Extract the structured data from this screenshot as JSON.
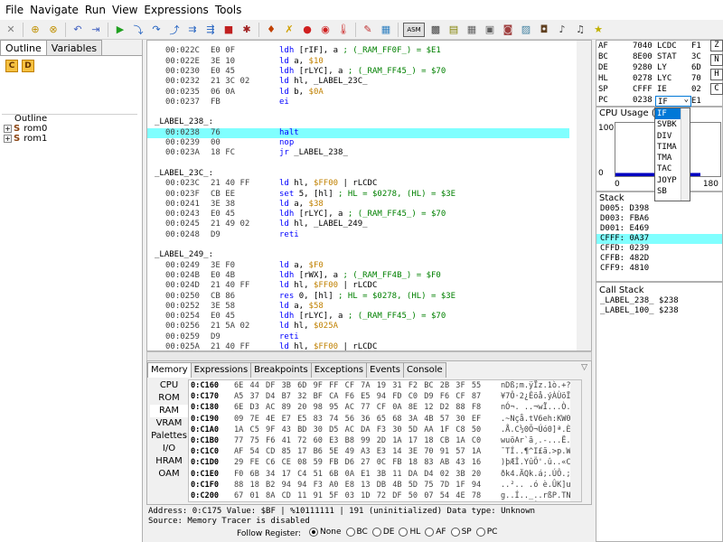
{
  "menu": [
    "File",
    "Navigate",
    "Run",
    "View",
    "Expressions",
    "Tools"
  ],
  "toolbar_icons": [
    "close-icon",
    "breakpoint-add-icon",
    "breakpoint-remove-icon",
    "step-back-icon",
    "goto-icon",
    "run-icon",
    "step-into-icon",
    "step-over-icon",
    "step-out-icon",
    "run-frame-icon",
    "run-scanline-icon",
    "stop-icon",
    "bug-icon",
    "speaker-icon",
    "reset-icon",
    "record-icon",
    "record-stop-icon",
    "thermometer-icon",
    "pencil-icon",
    "tilemap-icon",
    "asm-icon",
    "grid-icon",
    "palette-icon",
    "grid-small-icon",
    "tile-icon",
    "sprite-icon",
    "image-icon",
    "chip-icon",
    "music-note-icon",
    "music-icon",
    "star-icon"
  ],
  "left": {
    "tabs": [
      "Outline",
      "Variables"
    ],
    "tree_title": "Outline",
    "items": [
      "rom0",
      "rom1"
    ]
  },
  "disasm": {
    "lines": [
      {
        "type": "code",
        "addr": "00:022C",
        "bytes": "E0 0F",
        "code": [
          [
            "kw",
            "ldh "
          ],
          [
            "lbl",
            "[rIF], a   "
          ],
          [
            "cmt",
            "; (_RAM_FF0F_) = $E1"
          ]
        ]
      },
      {
        "type": "code",
        "addr": "00:022E",
        "bytes": "3E 10",
        "code": [
          [
            "kw",
            "ld "
          ],
          [
            "lbl",
            "a, "
          ],
          [
            "num",
            "$10"
          ]
        ]
      },
      {
        "type": "code",
        "addr": "00:0230",
        "bytes": "E0 45",
        "code": [
          [
            "kw",
            "ldh "
          ],
          [
            "lbl",
            "[rLYC], a    "
          ],
          [
            "cmt",
            "; (_RAM_FF45_) = $70"
          ]
        ]
      },
      {
        "type": "code",
        "addr": "00:0232",
        "bytes": "21 3C 02",
        "code": [
          [
            "kw",
            "ld "
          ],
          [
            "lbl",
            "hl, _LABEL_23C_"
          ]
        ]
      },
      {
        "type": "code",
        "addr": "00:0235",
        "bytes": "06 0A",
        "code": [
          [
            "kw",
            "ld "
          ],
          [
            "lbl",
            "b, "
          ],
          [
            "num",
            "$0A"
          ]
        ]
      },
      {
        "type": "code",
        "addr": "00:0237",
        "bytes": "FB",
        "code": [
          [
            "kw",
            "ei"
          ]
        ]
      },
      {
        "type": "blank"
      },
      {
        "type": "label",
        "addr": "_LABEL_238_:"
      },
      {
        "type": "code",
        "addr": "00:0238",
        "bytes": "76",
        "hl": true,
        "code": [
          [
            "kw",
            "halt"
          ]
        ]
      },
      {
        "type": "code",
        "addr": "00:0239",
        "bytes": "00",
        "code": [
          [
            "kw",
            "nop"
          ]
        ]
      },
      {
        "type": "code",
        "addr": "00:023A",
        "bytes": "18 FC",
        "code": [
          [
            "kw",
            "jr "
          ],
          [
            "lbl",
            "_LABEL_238_"
          ]
        ]
      },
      {
        "type": "blank"
      },
      {
        "type": "label",
        "addr": "_LABEL_23C_:"
      },
      {
        "type": "code",
        "addr": "00:023C",
        "bytes": "21 40 FF",
        "code": [
          [
            "kw",
            "ld "
          ],
          [
            "lbl",
            "hl, "
          ],
          [
            "num",
            "$FF00"
          ],
          [
            "lbl",
            " | rLCDC"
          ]
        ]
      },
      {
        "type": "code",
        "addr": "00:023F",
        "bytes": "CB EE",
        "code": [
          [
            "kw",
            "set "
          ],
          [
            "lbl",
            "5, [hl]    "
          ],
          [
            "cmt",
            "; HL = $0278, (HL) = $3E"
          ]
        ]
      },
      {
        "type": "code",
        "addr": "00:0241",
        "bytes": "3E 38",
        "code": [
          [
            "kw",
            "ld "
          ],
          [
            "lbl",
            "a, "
          ],
          [
            "num",
            "$38"
          ]
        ]
      },
      {
        "type": "code",
        "addr": "00:0243",
        "bytes": "E0 45",
        "code": [
          [
            "kw",
            "ldh "
          ],
          [
            "lbl",
            "[rLYC], a    "
          ],
          [
            "cmt",
            "; (_RAM_FF45_) = $70"
          ]
        ]
      },
      {
        "type": "code",
        "addr": "00:0245",
        "bytes": "21 49 02",
        "code": [
          [
            "kw",
            "ld "
          ],
          [
            "lbl",
            "hl, _LABEL_249_"
          ]
        ]
      },
      {
        "type": "code",
        "addr": "00:0248",
        "bytes": "D9",
        "code": [
          [
            "kw",
            "reti"
          ]
        ]
      },
      {
        "type": "blank"
      },
      {
        "type": "label",
        "addr": "_LABEL_249_:"
      },
      {
        "type": "code",
        "addr": "00:0249",
        "bytes": "3E F0",
        "code": [
          [
            "kw",
            "ld "
          ],
          [
            "lbl",
            "a, "
          ],
          [
            "num",
            "$F0"
          ]
        ]
      },
      {
        "type": "code",
        "addr": "00:024B",
        "bytes": "E0 4B",
        "code": [
          [
            "kw",
            "ldh "
          ],
          [
            "lbl",
            "[rWX], a    "
          ],
          [
            "cmt",
            "; (_RAM_FF4B_) = $F0"
          ]
        ]
      },
      {
        "type": "code",
        "addr": "00:024D",
        "bytes": "21 40 FF",
        "code": [
          [
            "kw",
            "ld "
          ],
          [
            "lbl",
            "hl, "
          ],
          [
            "num",
            "$FF00"
          ],
          [
            "lbl",
            " | rLCDC"
          ]
        ]
      },
      {
        "type": "code",
        "addr": "00:0250",
        "bytes": "CB 86",
        "code": [
          [
            "kw",
            "res "
          ],
          [
            "lbl",
            "0, [hl]    "
          ],
          [
            "cmt",
            "; HL = $0278, (HL) = $3E"
          ]
        ]
      },
      {
        "type": "code",
        "addr": "00:0252",
        "bytes": "3E 58",
        "code": [
          [
            "kw",
            "ld "
          ],
          [
            "lbl",
            "a, "
          ],
          [
            "num",
            "$58"
          ]
        ]
      },
      {
        "type": "code",
        "addr": "00:0254",
        "bytes": "E0 45",
        "code": [
          [
            "kw",
            "ldh "
          ],
          [
            "lbl",
            "[rLYC], a    "
          ],
          [
            "cmt",
            "; (_RAM_FF45_) = $70"
          ]
        ]
      },
      {
        "type": "code",
        "addr": "00:0256",
        "bytes": "21 5A 02",
        "code": [
          [
            "kw",
            "ld "
          ],
          [
            "lbl",
            "hl, "
          ],
          [
            "num",
            "$025A"
          ]
        ]
      },
      {
        "type": "code",
        "addr": "00:0259",
        "bytes": "D9",
        "code": [
          [
            "kw",
            "reti"
          ]
        ]
      },
      {
        "type": "code",
        "addr": "00:025A",
        "bytes": "21 40 FF",
        "code": [
          [
            "kw",
            "ld "
          ],
          [
            "lbl",
            "hl, "
          ],
          [
            "num",
            "$FF00"
          ],
          [
            "lbl",
            " | rLCDC"
          ]
        ]
      }
    ]
  },
  "memory": {
    "tabs": [
      "Memory",
      "Expressions",
      "Breakpoints",
      "Exceptions",
      "Events",
      "Console"
    ],
    "categories": [
      "CPU",
      "ROM",
      "RAM",
      "VRAM",
      "Palettes",
      "I/O",
      "HRAM",
      "OAM"
    ],
    "selected_category": "RAM",
    "rows": [
      {
        "addr": "0:C160",
        "bytes": "6E 44 DF 3B 6D 9F FF CF 7A 19 31 F2 BC 2B 3F 55",
        "ascii": "nDß;m.ÿÏz.1ò.+?U"
      },
      {
        "addr": "0:C170",
        "bytes": "A5 37 D4 B7 32 BF CA F6 E5 94 FD C0 D9 F6 CF 87",
        "ascii": "¥7Ô·2¿Êöå.ýÀÙöÏ."
      },
      {
        "addr": "0:C180",
        "bytes": "6E D3 AC 89 20 98 95 AC 77 CF 0A 8E 12 D2 88 F8",
        "ascii": "nÓ¬. ..¬wÏ...Ò.ø"
      },
      {
        "addr": "0:C190",
        "bytes": "09 7E 4E E7 E5 83 74 56 36 65 68 3A 4B 57 30 EF",
        "ascii": ".~Nçå.tV6eh:KW0ï"
      },
      {
        "addr": "0:C1A0",
        "bytes": "1A C5 9F 43 BD 30 D5 AC DA F3 30 5D AA 1F C8 50",
        "ascii": ".Å.C½0Õ¬Úó0]ª.ÈP"
      },
      {
        "addr": "0:C1B0",
        "bytes": "77 75 F6 41 72 60 E3 B8 99 2D 1A 17 18 CB 1A C0",
        "ascii": "wuöAr`ã¸.-...Ë.À"
      },
      {
        "addr": "0:C1C0",
        "bytes": "AF 54 CD 85 17 B6 5E 49 A3 E3 14 3E 70 91 57 1A",
        "ascii": "¯TÍ..¶^I£ã.>p.W."
      },
      {
        "addr": "0:C1D0",
        "bytes": "29 FE C6 CE 08 59 FB D6 27 0C FB 18 83 AB 43 16",
        "ascii": ")þÆÎ.YûÖ'.û..«C."
      },
      {
        "addr": "0:C1E0",
        "bytes": "F0 6B 34 17 C4 51 6B 0A E1 3B 11 DA D4 02 3B 20",
        "ascii": "ðk4.ÄQk.á;.ÚÔ.; "
      },
      {
        "addr": "0:C1F0",
        "bytes": "88 18 B2 94 94 F3 A0 E8 13 DB 4B 5D 75 7D 1F 94",
        "ascii": "..².. .ó è.ÛK]u}."
      },
      {
        "addr": "0:C200",
        "bytes": "67 01 8A CD 11 91 5F 03 1D 72 DF 50 07 54 4E 78",
        "ascii": "g..Í.._..rßP.TNx"
      },
      {
        "addr": "0:C210",
        "bytes": "E3 93 E5 33 24 78 85 D4 4E 2F A8 26 30 90 32 BF",
        "ascii": "ã.å3$x.ÔN/¨&0.2¿"
      }
    ]
  },
  "status": {
    "line1": "Address: 0:C175   Value: $BF | %10111111 | 191 (uninitialized)   Data type: Unknown",
    "line2": "Source: Memory Tracer is disabled",
    "follow_label": "Follow Register:",
    "follow_options": [
      "None",
      "BC",
      "DE",
      "HL",
      "AF",
      "SP",
      "PC"
    ],
    "follow_selected": "None"
  },
  "registers": {
    "left": [
      [
        "AF",
        "7040"
      ],
      [
        "BC",
        "8E00"
      ],
      [
        "DE",
        "9280"
      ],
      [
        "HL",
        "0278"
      ],
      [
        "SP",
        "CFFF"
      ],
      [
        "PC",
        "0238"
      ]
    ],
    "mid": [
      [
        "LCDC",
        "F1"
      ],
      [
        "STAT",
        "3C"
      ],
      [
        "LY",
        "6D"
      ],
      [
        "LYC",
        "70"
      ],
      [
        "IE",
        "02"
      ],
      [
        "IF",
        "E1"
      ]
    ],
    "right_letters": [
      "Z",
      "N",
      "H",
      "C"
    ],
    "dropdown_value": "IF"
  },
  "dropdown_options": [
    "IF",
    "SVBK",
    "DIV",
    "TIMA",
    "TMA",
    "TAC",
    "JOYP",
    "SB"
  ],
  "cpu": {
    "title": "CPU Usage (%",
    "ymax": "100",
    "ymin": "0",
    "xmin": "0",
    "xmax": "180",
    "usage": 0.06
  },
  "stack": {
    "title": "Stack",
    "rows": [
      {
        "text": "D005: D398"
      },
      {
        "text": "D003: FBA6"
      },
      {
        "text": "D001: E469"
      },
      {
        "text": "CFFF: 0A37",
        "hl": true
      },
      {
        "text": "CFFD: 0239"
      },
      {
        "text": "CFFB: 482D"
      },
      {
        "text": "CFF9: 4810"
      }
    ]
  },
  "callstack": {
    "title": "Call Stack",
    "rows": [
      "_LABEL_238_  $238",
      "_LABEL_100_  $238"
    ]
  }
}
